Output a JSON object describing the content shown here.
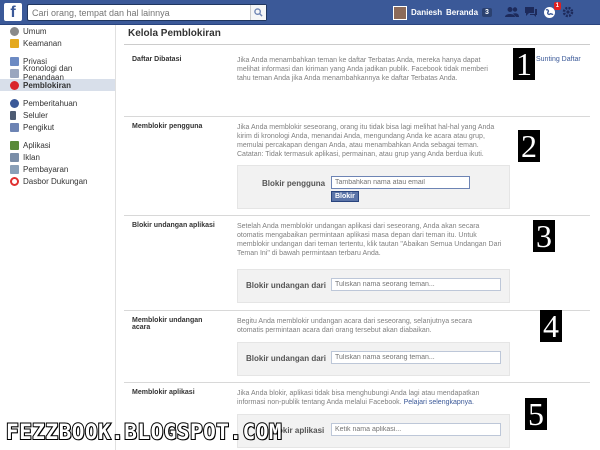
{
  "topbar": {
    "logo": "f",
    "search_placeholder": "Cari orang, tempat dan hal lainnya",
    "profile_name": "Daniesh",
    "home_label": "Beranda",
    "home_count": "3",
    "notification_count": "1",
    "color": "#3b5998"
  },
  "sidebar": {
    "items": [
      {
        "label": "Umum",
        "icon": "gear-icon",
        "color": "#8a8a8a"
      },
      {
        "label": "Keamanan",
        "icon": "lock-icon",
        "color": "#e4a91e"
      },
      {
        "label": "Privasi",
        "icon": "privacy-icon",
        "color": "#6c8ac3"
      },
      {
        "label": "Kronologi dan Penandaan",
        "icon": "timeline-icon",
        "color": "#9aa6bf"
      },
      {
        "label": "Pemblokiran",
        "icon": "block-icon",
        "color": "#d9252a"
      },
      {
        "label": "Pemberitahuan",
        "icon": "globe-icon",
        "color": "#3b5998"
      },
      {
        "label": "Seluler",
        "icon": "mobile-icon",
        "color": "#4d5b73"
      },
      {
        "label": "Pengikut",
        "icon": "follower-icon",
        "color": "#6d84b4"
      },
      {
        "label": "Aplikasi",
        "icon": "apps-icon",
        "color": "#5a8a3a"
      },
      {
        "label": "Iklan",
        "icon": "ads-icon",
        "color": "#7a8ea8"
      },
      {
        "label": "Pembayaran",
        "icon": "payment-icon",
        "color": "#8aa0b8"
      },
      {
        "label": "Dasbor Dukungan",
        "icon": "support-icon",
        "color": "#e03030"
      }
    ]
  },
  "main": {
    "title": "Kelola Pemblokiran",
    "sections": [
      {
        "label": "Daftar Dibatasi",
        "desc": [
          "Jika Anda menambahkan teman ke daftar Terbatas Anda, mereka hanya dapat",
          "melihat informasi dan kiriman yang Anda jadikan publik. Facebook tidak memberi",
          "tahu teman Anda jika Anda menambahkannya ke daftar Terbatas Anda."
        ],
        "link": "Sunting Daftar"
      },
      {
        "label": "Memblokir pengguna",
        "desc": [
          "Jika Anda memblokir seseorang, orang itu tidak bisa lagi melihat hal-hal yang Anda",
          "kirim di kronologi Anda, menandai Anda, mengundang Anda ke acara atau grup,",
          "memulai percakapan dengan Anda, atau menambahkan Anda sebagai teman.",
          "Catatan: Tidak termasuk aplikasi, permainan, atau grup yang Anda berdua ikuti."
        ],
        "field_label": "Blokir pengguna",
        "placeholder": "Tambahkan nama atau email",
        "button": "Blokir"
      },
      {
        "label": "Blokir undangan aplikasi",
        "desc": [
          "Setelah Anda memblokir undangan aplikasi dari seseorang, Anda akan secara",
          "otomatis mengabaikan permintaan aplikasi masa depan dari teman itu. Untuk",
          "memblokir undangan dari teman tertentu, klik tautan \"Abaikan Semua Undangan Dari",
          "Teman Ini\" di bawah permintaan terbaru Anda."
        ],
        "field_label": "Blokir undangan dari",
        "placeholder": "Tuliskan nama seorang teman..."
      },
      {
        "label": "Memblokir undangan acara",
        "desc": [
          "Begitu Anda memblokir undangan acara dari seseorang, selanjutnya secara",
          "otomatis permintaan acara dari orang tersebut akan diabaikan."
        ],
        "field_label": "Blokir undangan dari",
        "placeholder": "Tuliskan nama seorang teman..."
      },
      {
        "label": "Memblokir aplikasi",
        "desc": [
          "Jika Anda blokir, aplikasi tidak bisa menghubungi Anda lagi atau mendapatkan",
          "informasi non-publik tentang Anda melalui Facebook."
        ],
        "desc_link": "Pelajari selengkapnya.",
        "field_label": "Blokir aplikasi",
        "placeholder": "Ketik nama aplikasi..."
      }
    ]
  },
  "annotations": [
    "1",
    "2",
    "3",
    "4",
    "5"
  ],
  "watermark": "FEZZBOOK.BLOGSPOT.COM"
}
